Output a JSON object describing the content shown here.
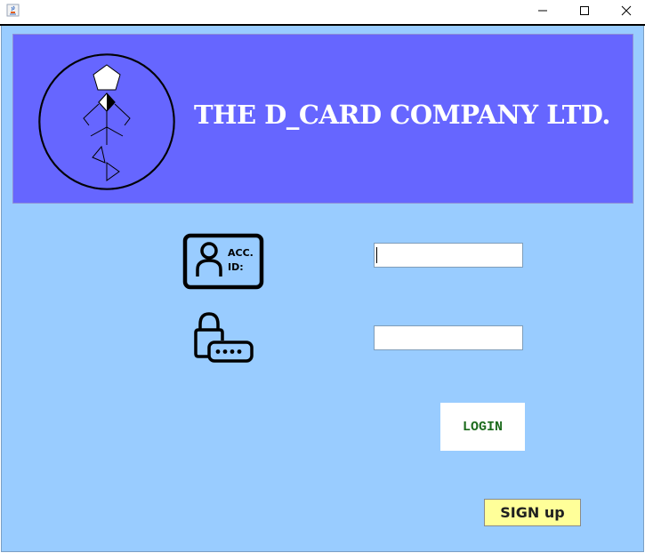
{
  "window": {
    "controls": {
      "minimize": "—",
      "maximize": "☐",
      "close": "✕"
    }
  },
  "banner": {
    "title": "THE D_CARD COMPANY LTD.",
    "logo_icon": "d-card-logo-icon"
  },
  "account": {
    "icon": "id-card-icon",
    "icon_text_line1": "ACC.",
    "icon_text_line2": "ID:",
    "value": ""
  },
  "password": {
    "icon": "lock-password-icon",
    "value": ""
  },
  "buttons": {
    "login_label": "LOGIN",
    "signup_label": "SIGN up"
  },
  "colors": {
    "background": "#99ccff",
    "banner": "#6666ff",
    "login_text": "#1d6b1d",
    "signup_bg": "#ffff99"
  }
}
